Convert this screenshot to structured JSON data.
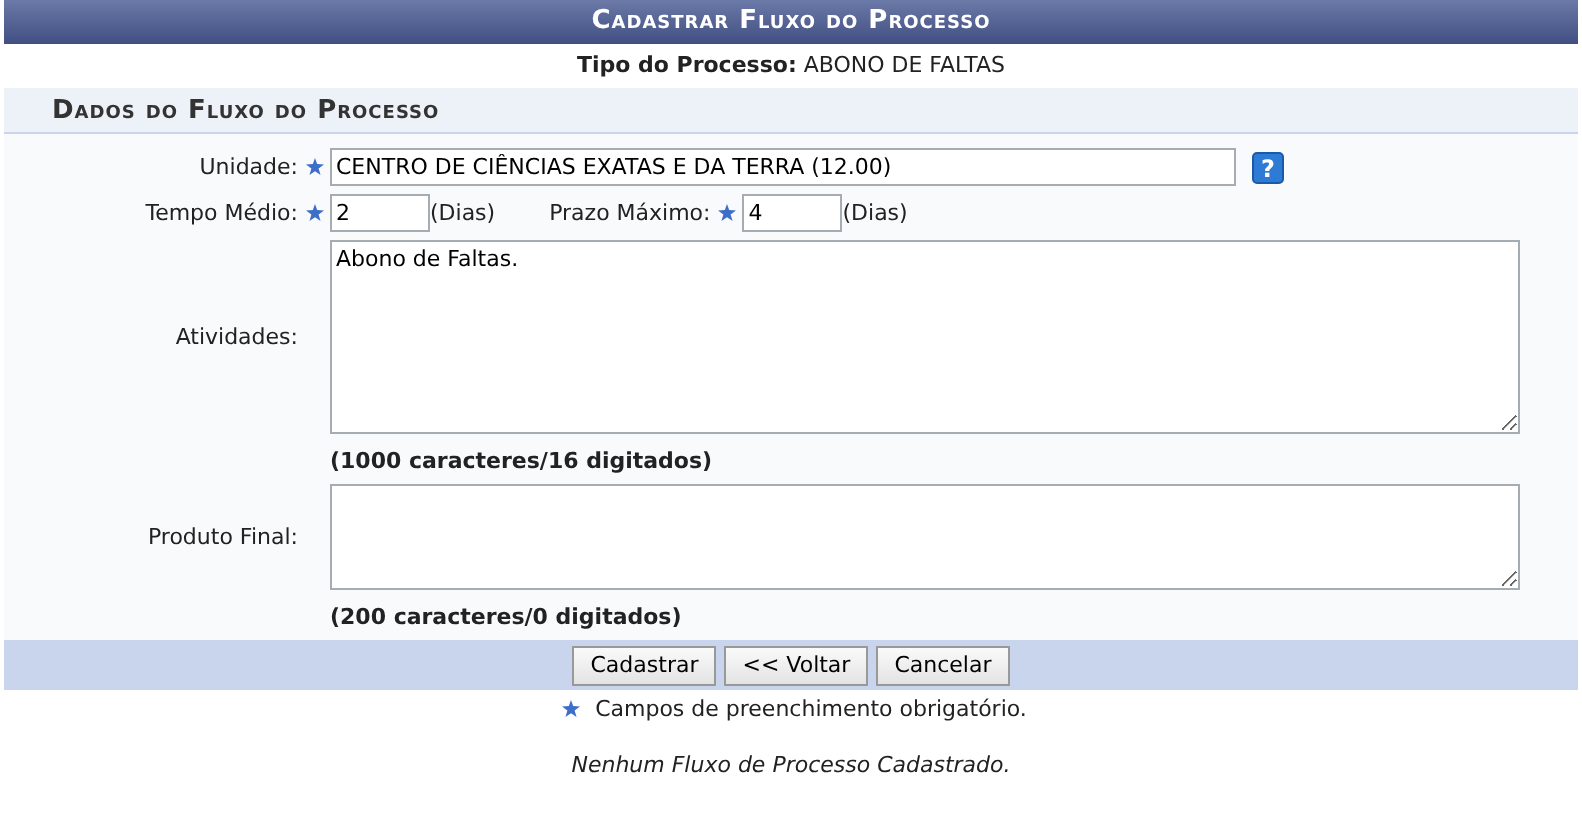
{
  "title": "Cadastrar Fluxo do Processo",
  "process_type": {
    "label": "Tipo do Processo:",
    "value": "ABONO DE FALTAS"
  },
  "section_title": "Dados do Fluxo do Processo",
  "unit": {
    "label": "Unidade:",
    "required": true,
    "value": "CENTRO DE CIÊNCIAS EXATAS E DA TERRA (12.00)",
    "help": "?"
  },
  "average_time": {
    "label": "Tempo Médio:",
    "required": true,
    "value": "2",
    "unit": "(Dias)"
  },
  "max_time": {
    "label": "Prazo Máximo:",
    "required": true,
    "value": "4",
    "unit": "(Dias)"
  },
  "activities": {
    "label": "Atividades:",
    "value": "Abono de Faltas.",
    "counter": "(1000 caracteres/16 digitados)"
  },
  "final_product": {
    "label": "Produto Final:",
    "counter": "(200 caracteres/0 digitados)"
  },
  "buttons": [
    "Cadastrar",
    "<< Voltar",
    "Cancelar"
  ],
  "required_note": "Campos de preenchimento obrigatório.",
  "empty_message": "Nenhum Fluxo de Processo Cadastrado."
}
